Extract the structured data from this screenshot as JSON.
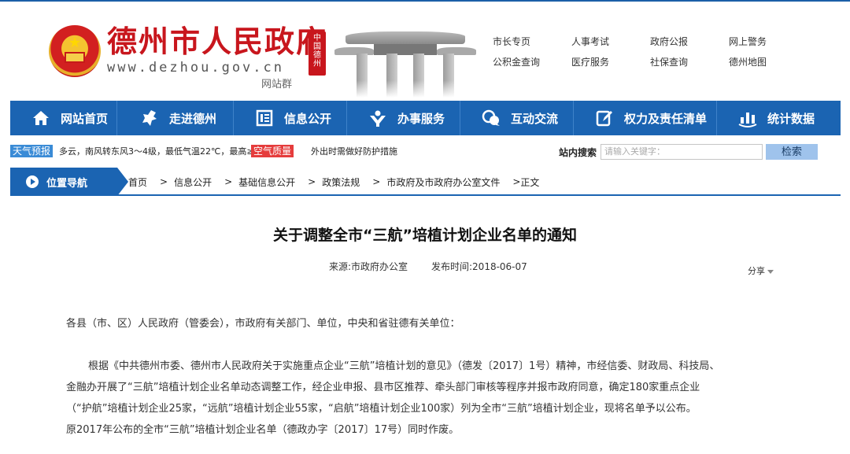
{
  "header": {
    "site_name": "德州市人民政府",
    "site_domain": "www.dezhou.gov.cn",
    "site_group": "网站群",
    "seal_text": "中国德州",
    "quick_links": [
      "市长专页",
      "人事考试",
      "政府公报",
      "网上警务",
      "公积金查询",
      "医疗服务",
      "社保查询",
      "德州地图"
    ]
  },
  "nav": {
    "items": [
      {
        "label": "网站首页",
        "icon": "home-icon"
      },
      {
        "label": "走进德州",
        "icon": "map-icon"
      },
      {
        "label": "信息公开",
        "icon": "document-icon"
      },
      {
        "label": "办事服务",
        "icon": "service-icon"
      },
      {
        "label": "互动交流",
        "icon": "chat-icon"
      },
      {
        "label": "权力及责任清单",
        "icon": "edit-list-icon"
      },
      {
        "label": "统计数据",
        "icon": "statistics-icon"
      }
    ]
  },
  "infobar": {
    "weather_tag": "天气预报",
    "weather_text": "多云，南风转东风3～4级，最低气温22℃，最高≥",
    "air_tag": "空气质量",
    "air_text": "外出时需做好防护措施",
    "search_label": "站内搜索",
    "search_placeholder": "请输入关键字：",
    "search_button": "检索"
  },
  "breadcrumb": {
    "heading": "位置导航",
    "items": [
      "首页",
      "信息公开",
      "基础信息公开",
      "政策法规",
      "市政府及市政府办公室文件",
      "正文"
    ]
  },
  "article": {
    "title": "关于调整全市“三航”培植计划企业名单的通知",
    "source": "来源:市政府办公室",
    "date": "发布时间:2018-06-07",
    "share": "分享",
    "salutation": "各县（市、区）人民政府（管委会），市政府有关部门、单位，中央和省驻德有关单位：",
    "paragraph_lines": [
      "根据《中共德州市委、德州市人民政府关于实施重点企业“三航”培植计划的意见》（德发〔2017〕1号）精神，市经信委、财政局、科技局、",
      "金融办开展了“三航”培植计划企业名单动态调整工作，经企业申报、县市区推荐、牵头部门审核等程序并报市政府同意，确定180家重点企业",
      "（“护航”培植计划企业25家，“远航”培植计划企业55家，“启航”培植计划企业100家）列为全市“三航”培植计划企业，现将名单予以公布。",
      "原2017年公布的全市“三航”培植计划企业名单（德政办字〔2017〕17号）同时作废。"
    ]
  },
  "colors": {
    "brand_red": "#c8161d",
    "nav_blue": "#1b64b2",
    "weather_tag": "#3a8bd6",
    "air_tag": "#e53c3c",
    "search_button": "#9fc3ec"
  }
}
